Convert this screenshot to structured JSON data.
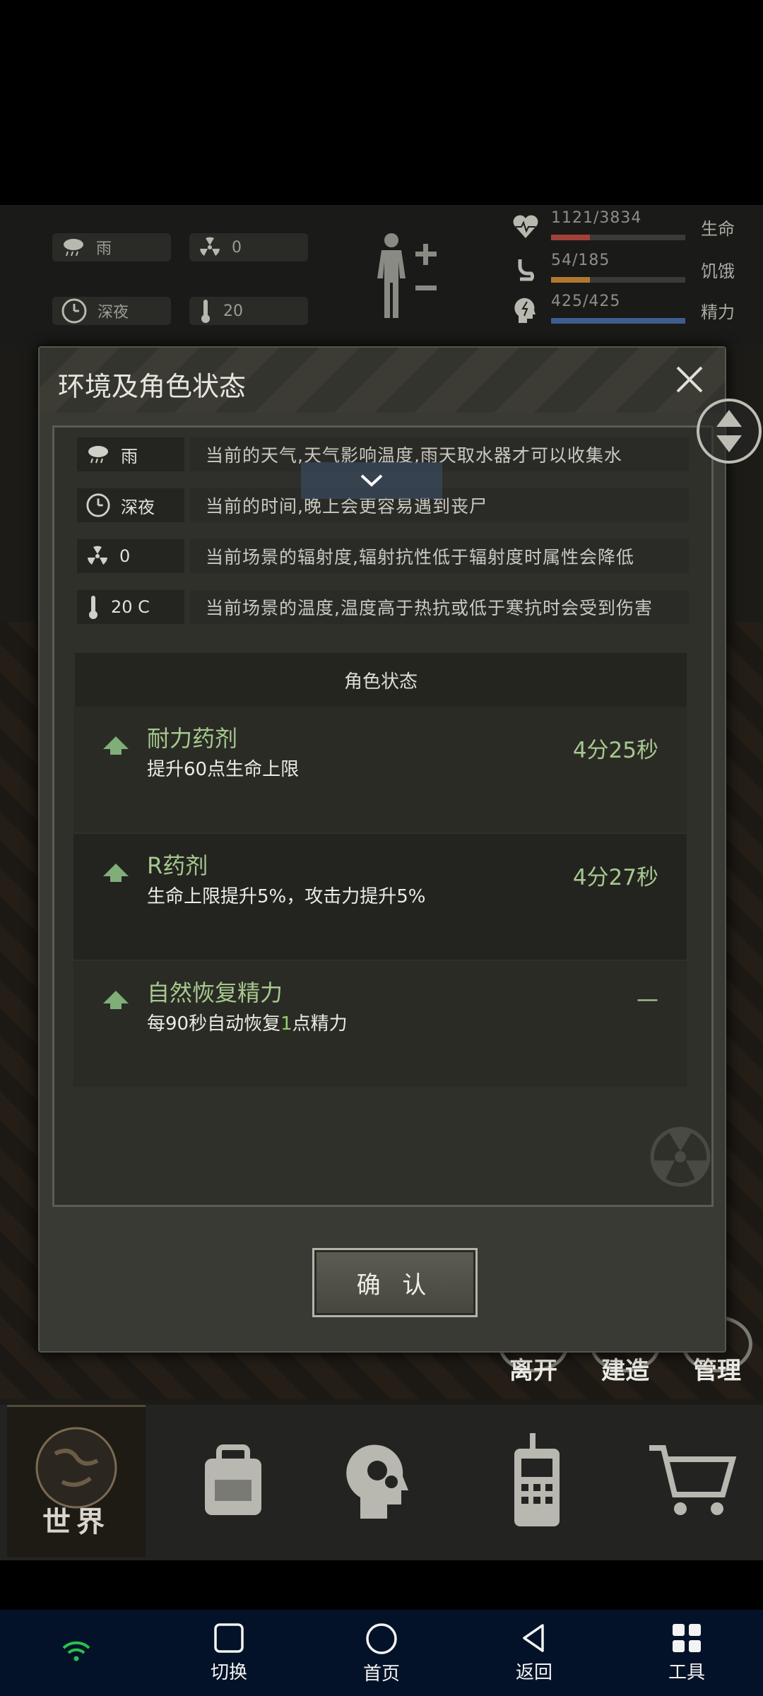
{
  "hud": {
    "weather": "雨",
    "radiation": "0",
    "time_of_day": "深夜",
    "temperature": "20",
    "stats": [
      {
        "value": "1121/3834",
        "label": "生命",
        "fill": 0.29,
        "color": "#a0413a"
      },
      {
        "value": "54/185",
        "label": "饥饿",
        "fill": 0.29,
        "color": "#b0782f"
      },
      {
        "value": "425/425",
        "label": "精力",
        "fill": 1.0,
        "color": "#3f5d8e"
      }
    ]
  },
  "dialog": {
    "title": "环境及角色状态",
    "env_rows": [
      {
        "icon": "rain-cloud-icon",
        "value": "雨",
        "desc": "当前的天气,天气影响温度,雨天取水器才可以收集水"
      },
      {
        "icon": "clock-icon",
        "value": "深夜",
        "desc": "当前的时间,晚上会更容易遇到丧尸"
      },
      {
        "icon": "radiation-icon",
        "value": "0",
        "desc": "当前场景的辐射度,辐射抗性低于辐射度时属性会降低"
      },
      {
        "icon": "thermometer-icon",
        "value": "20 C",
        "desc": "当前场景的温度,温度高于热抗或低于寒抗时会受到伤害"
      }
    ],
    "status_header": "角色状态",
    "status_items": [
      {
        "name": "耐力药剂",
        "desc": "提升60点生命上限",
        "time": "4分25秒"
      },
      {
        "name": "R药剂",
        "desc": "生命上限提升5%，攻击力提升5%",
        "time": "4分27秒"
      },
      {
        "name": "自然恢复精力",
        "desc_pre": "每90秒自动恢复",
        "desc_hl": "1",
        "desc_post": "点精力",
        "time": "—"
      }
    ],
    "confirm_label": "确 认"
  },
  "base_buttons": [
    {
      "label": "离开"
    },
    {
      "label": "建造"
    },
    {
      "label": "管理"
    }
  ],
  "bottom_nav": {
    "world_label": "世界"
  },
  "system_nav": [
    {
      "label": "切换",
      "icon": "square-icon"
    },
    {
      "label": "首页",
      "icon": "circle-icon"
    },
    {
      "label": "返回",
      "icon": "back-triangle-icon"
    },
    {
      "label": "工具",
      "icon": "grid-icon"
    }
  ]
}
